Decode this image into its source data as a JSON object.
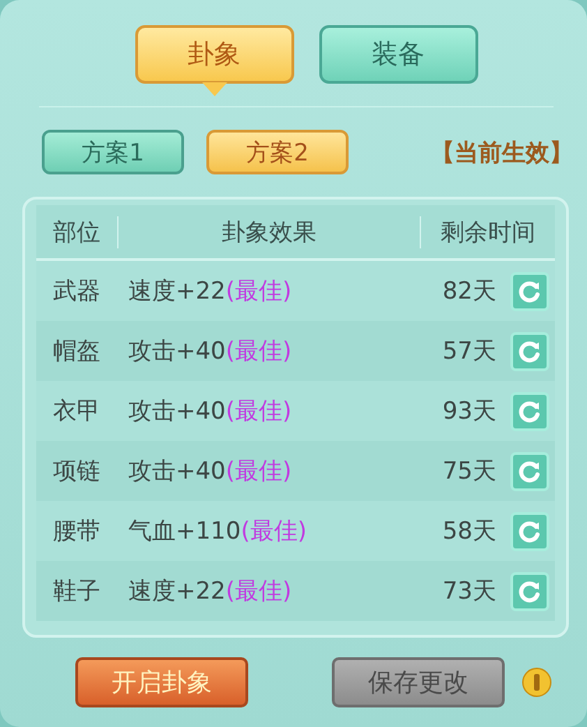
{
  "tabs": [
    {
      "label": "卦象",
      "selected": true
    },
    {
      "label": "装备",
      "selected": false
    }
  ],
  "schemes": [
    {
      "label": "方案1",
      "selected": false
    },
    {
      "label": "方案2",
      "selected": true
    }
  ],
  "status": "【当前生效】",
  "table": {
    "columns": [
      "部位",
      "卦象效果",
      "剩余时间"
    ],
    "rows": [
      {
        "slot": "武器",
        "effect": "速度+22",
        "tag": "(最佳)",
        "time": "82天"
      },
      {
        "slot": "帽盔",
        "effect": "攻击+40",
        "tag": "(最佳)",
        "time": "57天"
      },
      {
        "slot": "衣甲",
        "effect": "攻击+40",
        "tag": "(最佳)",
        "time": "93天"
      },
      {
        "slot": "项链",
        "effect": "攻击+40",
        "tag": "(最佳)",
        "time": "75天"
      },
      {
        "slot": "腰带",
        "effect": "气血+110",
        "tag": "(最佳)",
        "time": "58天"
      },
      {
        "slot": "鞋子",
        "effect": "速度+22",
        "tag": "(最佳)",
        "time": "73天"
      }
    ]
  },
  "buttons": [
    {
      "label": "开启卦象",
      "disabled": false
    },
    {
      "label": "保存更改",
      "disabled": true
    }
  ]
}
